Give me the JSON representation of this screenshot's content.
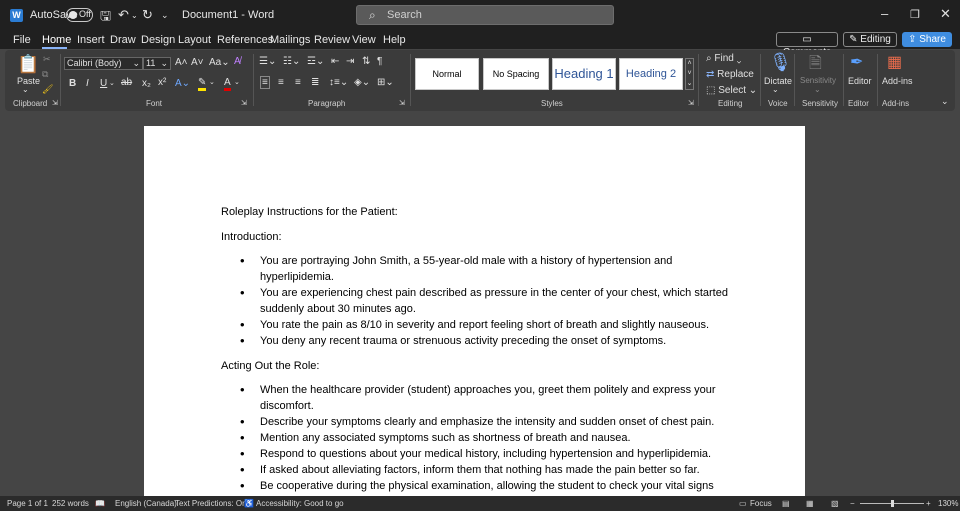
{
  "titlebar": {
    "autosave_label": "AutoSave",
    "autosave_state": "Off",
    "doc_title": "Document1 - Word",
    "search_placeholder": "Search"
  },
  "menu": {
    "tabs": [
      "File",
      "Home",
      "Insert",
      "Draw",
      "Design",
      "Layout",
      "References",
      "Mailings",
      "Review",
      "View",
      "Help"
    ],
    "comments": "Comments",
    "editing": "Editing",
    "share": "Share"
  },
  "ribbon": {
    "paste": "Paste",
    "font_name": "Calibri (Body)",
    "font_size": "11",
    "styles": [
      "Normal",
      "No Spacing",
      "Heading 1",
      "Heading 2"
    ],
    "find": "Find",
    "replace": "Replace",
    "select": "Select",
    "dictate": "Dictate",
    "sensitivity": "Sensitivity",
    "editor": "Editor",
    "addins": "Add-ins",
    "groups": [
      "Clipboard",
      "Font",
      "Paragraph",
      "Styles",
      "Editing",
      "Voice",
      "Sensitivity",
      "Editor",
      "Add-ins"
    ]
  },
  "document": {
    "heading": "Roleplay Instructions for the Patient:",
    "intro_label": "Introduction:",
    "intro_items": [
      "You are portraying John Smith, a 55-year-old male with a history of hypertension and hyperlipidemia.",
      "You are experiencing chest pain described as pressure in the center of your chest, which started suddenly about 30 minutes ago.",
      "You rate the pain as 8/10 in severity and report feeling short of breath and slightly nauseous.",
      "You deny any recent trauma or strenuous activity preceding the onset of symptoms."
    ],
    "acting_label": "Acting Out the Role:",
    "acting_items": [
      "When the healthcare provider (student) approaches you, greet them politely and express your discomfort.",
      "Describe your symptoms clearly and emphasize the intensity and sudden onset of chest pain.",
      "Mention any associated symptoms such as shortness of breath and nausea.",
      "Respond to questions about your medical history, including hypertension and hyperlipidemia.",
      "If asked about alleviating factors, inform them that nothing has made the pain better so far.",
      "Be cooperative during the physical examination, allowing the student to check your vital signs"
    ]
  },
  "status": {
    "page": "Page 1 of 1",
    "words": "252 words",
    "language": "English (Canada)",
    "predictions": "Text Predictions: On",
    "accessibility": "Accessibility: Good to go",
    "focus": "Focus",
    "zoom": "130%"
  }
}
